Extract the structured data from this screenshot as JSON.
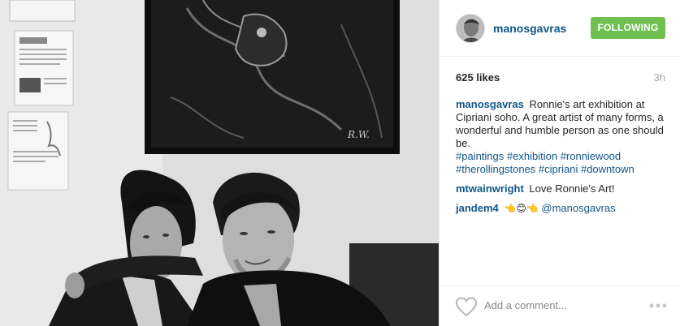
{
  "post": {
    "username": "manosgavras",
    "follow_button": "FOLLOWING",
    "likes": "625 likes",
    "time_ago": "3h",
    "caption": {
      "author": "manosgavras",
      "text": "Ronnie's art exhibition at Cipriani soho. A great artist of many forms, a wonderful and humble person as one should be.",
      "hashtags": [
        "#paintings",
        "#exhibition",
        "#ronniewood",
        "#therollingstones",
        "#cipriani",
        "#downtown"
      ]
    },
    "comments": [
      {
        "author": "mtwainwright",
        "text": "Love Ronnie's Art!"
      },
      {
        "author": "jandem4",
        "emoji": "👈😊👈",
        "mention": "@manosgavras"
      }
    ],
    "add_comment_placeholder": "Add a comment..."
  },
  "icons": {
    "like": "heart-outline-icon",
    "more": "more-options-icon"
  },
  "colors": {
    "link": "#125688",
    "follow_button": "#70c050",
    "muted": "#a5a7aa"
  }
}
